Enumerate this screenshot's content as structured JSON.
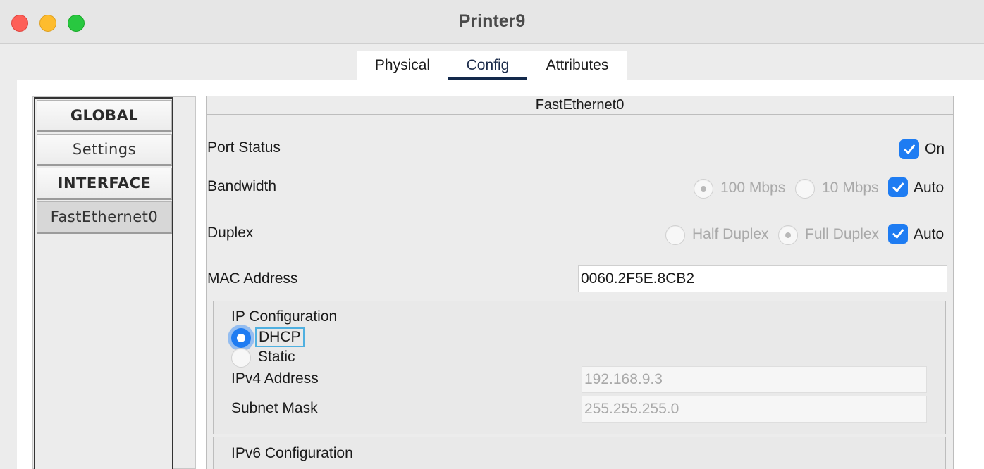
{
  "window": {
    "title": "Printer9"
  },
  "tabs": [
    {
      "label": "Physical"
    },
    {
      "label": "Config"
    },
    {
      "label": "Attributes"
    }
  ],
  "sidebar": {
    "global_header": "GLOBAL",
    "settings": "Settings",
    "interface_header": "INTERFACE",
    "fastethernet": "FastEthernet0"
  },
  "panel": {
    "title": "FastEthernet0",
    "port_status": {
      "label": "Port Status",
      "on_label": "On"
    },
    "bandwidth": {
      "label": "Bandwidth",
      "opt100": "100 Mbps",
      "opt10": "10 Mbps",
      "auto": "Auto"
    },
    "duplex": {
      "label": "Duplex",
      "half": "Half Duplex",
      "full": "Full Duplex",
      "auto": "Auto"
    },
    "mac": {
      "label": "MAC Address",
      "value": "0060.2F5E.8CB2"
    },
    "ip_config": {
      "title": "IP Configuration",
      "dhcp": "DHCP",
      "static": "Static",
      "ipv4_label": "IPv4 Address",
      "ipv4_value": "192.168.9.3",
      "subnet_label": "Subnet Mask",
      "subnet_value": "255.255.255.0"
    },
    "ipv6_config": {
      "title": "IPv6 Configuration"
    }
  },
  "colors": {
    "accent": "#1e7cf2",
    "tab_underline": "#13294b"
  }
}
